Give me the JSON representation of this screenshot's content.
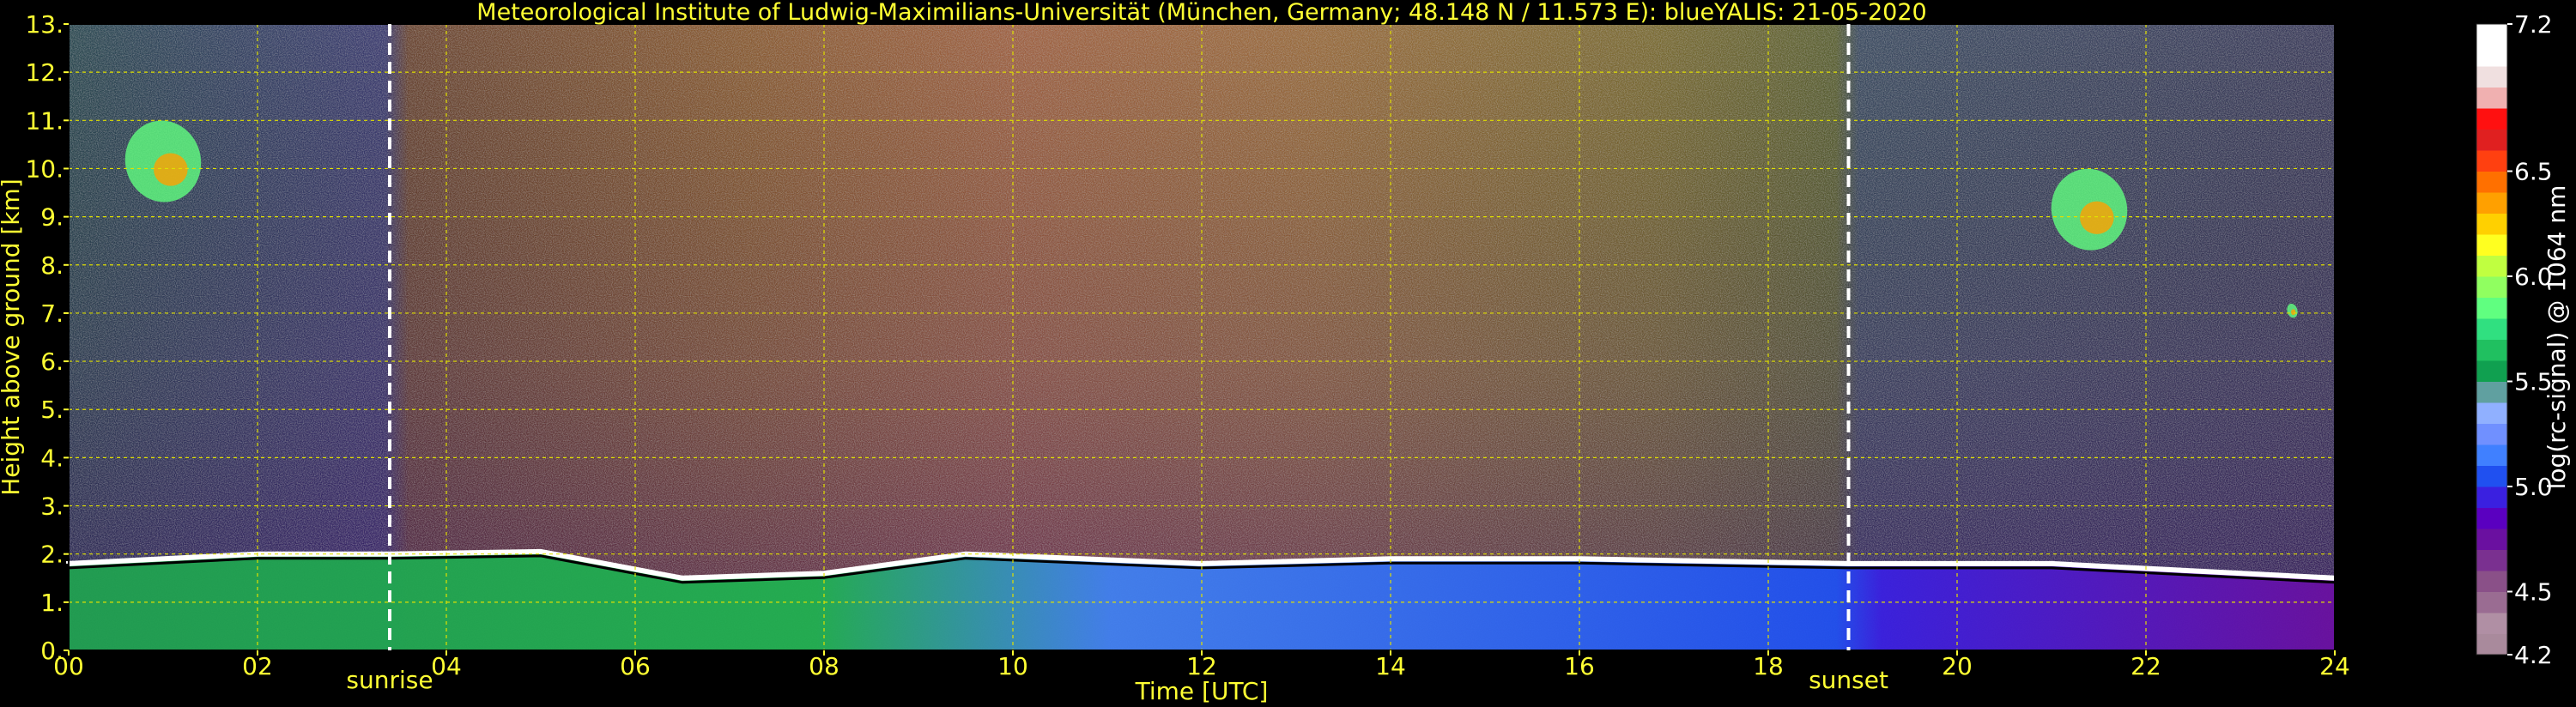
{
  "chart_data": {
    "type": "heatmap",
    "title": "Meteorological Institute of Ludwig-Maximilians-Universität (München, Germany; 48.148 N / 11.573 E):    blueYALIS: 21-05-2020",
    "xlabel": "Time [UTC]",
    "ylabel": "Height above ground [km]",
    "xlim": [
      0,
      24
    ],
    "ylim": [
      0,
      13
    ],
    "x_ticks": [
      "00",
      "02",
      "04",
      "06",
      "08",
      "10",
      "12",
      "14",
      "16",
      "18",
      "20",
      "22",
      "24"
    ],
    "y_ticks": [
      "0.",
      "1.",
      "2.",
      "3.",
      "4.",
      "5.",
      "6.",
      "7.",
      "8.",
      "9.",
      "10.",
      "11.",
      "12.",
      "13."
    ],
    "grid": true,
    "markers": [
      {
        "label": "sunrise",
        "x": 3.4
      },
      {
        "label": "sunset",
        "x": 18.85
      }
    ],
    "colorbar": {
      "label": "log(rc-signal) @ 1064 nm",
      "range": [
        4.2,
        7.2
      ],
      "ticks": [
        "4.2",
        "4.5",
        "5.0",
        "5.5",
        "6.0",
        "6.5",
        "7.2"
      ],
      "colors": [
        "#a98a9c",
        "#b08fa4",
        "#9a6c92",
        "#8a5088",
        "#7a3090",
        "#6a10a0",
        "#5a00c0",
        "#3a20e0",
        "#2050f0",
        "#4080ff",
        "#7090ff",
        "#90b0ff",
        "#60a0a0",
        "#10a050",
        "#20c060",
        "#30e080",
        "#60ff80",
        "#90ff60",
        "#c0ff40",
        "#ffff20",
        "#ffd000",
        "#ffa000",
        "#ff7000",
        "#ff4010",
        "#e02020",
        "#ff1010",
        "#f0b0b0",
        "#f0e0e0",
        "#ffffff",
        "#ffffff"
      ]
    },
    "boundary_layer_top_km": [
      {
        "x": 0,
        "y": 1.8
      },
      {
        "x": 2,
        "y": 2.0
      },
      {
        "x": 3.4,
        "y": 2.0
      },
      {
        "x": 5,
        "y": 2.05
      },
      {
        "x": 6.5,
        "y": 1.5
      },
      {
        "x": 8,
        "y": 1.6
      },
      {
        "x": 9.5,
        "y": 2.0
      },
      {
        "x": 12,
        "y": 1.8
      },
      {
        "x": 14,
        "y": 1.9
      },
      {
        "x": 16,
        "y": 1.9
      },
      {
        "x": 18.85,
        "y": 1.8
      },
      {
        "x": 21,
        "y": 1.8
      },
      {
        "x": 24,
        "y": 1.5
      }
    ],
    "cirrus_patches": [
      {
        "x": [
          0.6,
          1.4
        ],
        "y": [
          9.3,
          11.0
        ]
      },
      {
        "x": [
          21.0,
          21.8
        ],
        "y": [
          8.3,
          10.0
        ]
      },
      {
        "x": [
          23.5,
          23.6
        ],
        "y": [
          6.9,
          7.2
        ]
      }
    ]
  }
}
